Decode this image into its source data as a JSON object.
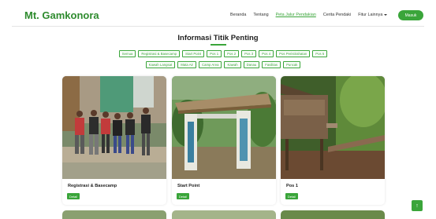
{
  "brand": "Mt. Gamkonora",
  "nav": {
    "links": [
      "Beranda",
      "Tentang",
      "Peta Jalur Pendakian",
      "Cerita Pendaki"
    ],
    "more_label": "Fitur Lainnya",
    "login_label": "Masuk"
  },
  "main": {
    "heading": "Informasi Titik Penting",
    "filters_row1": [
      "Semua",
      "Registrasi & Basecamp",
      "Start Point",
      "Pos 1",
      "Pos 2",
      "Pos 3",
      "Pos 4",
      "Pos Peristirahatan",
      "Pos 5"
    ],
    "filters_row2": [
      "Kawah Langsat",
      "Mata Air",
      "Camp Area",
      "Kawah",
      "Danau",
      "Fasilitas",
      "Puncak"
    ],
    "cards": [
      {
        "title": "Registrasi & Basecamp",
        "button": "Detail"
      },
      {
        "title": "Start Point",
        "button": "Detail"
      },
      {
        "title": "Pos 1",
        "button": "Detail"
      }
    ]
  },
  "colors": {
    "accent": "#3aa53a",
    "brand": "#2e8b2e"
  },
  "scroll_top_icon": "arrow-up-icon"
}
